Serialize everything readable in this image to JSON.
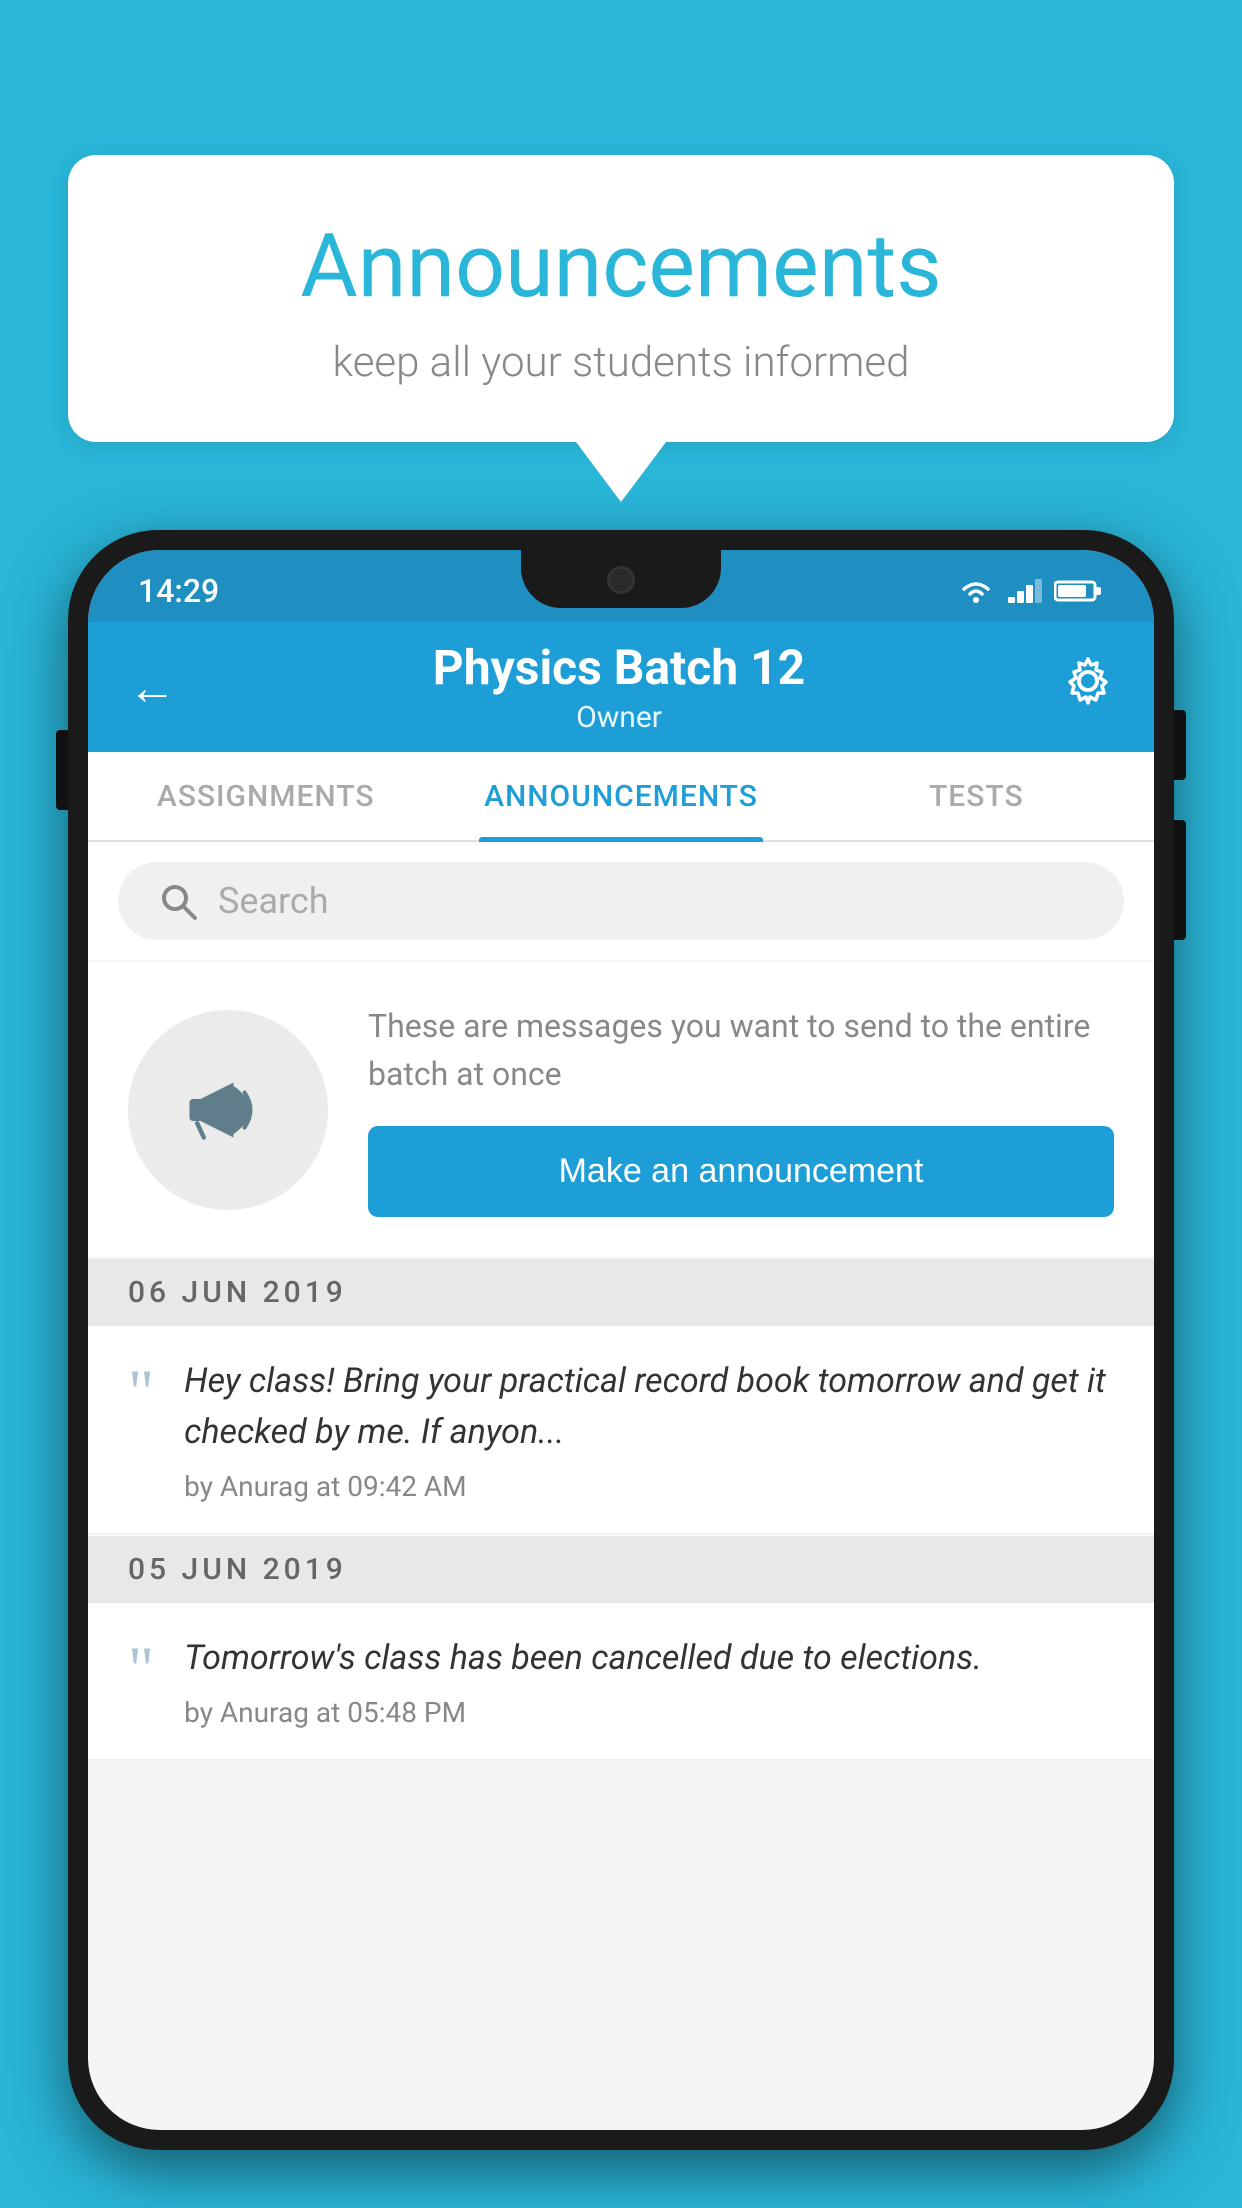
{
  "background_color": "#29b6d8",
  "speech_bubble": {
    "title": "Announcements",
    "subtitle": "keep all your students informed"
  },
  "status_bar": {
    "time": "14:29"
  },
  "app_header": {
    "title": "Physics Batch 12",
    "subtitle": "Owner",
    "back_label": "←"
  },
  "tabs": [
    {
      "label": "ASSIGNMENTS",
      "active": false
    },
    {
      "label": "ANNOUNCEMENTS",
      "active": true
    },
    {
      "label": "TESTS",
      "active": false
    }
  ],
  "search": {
    "placeholder": "Search"
  },
  "announcement_prompt": {
    "description": "These are messages you want to send to the entire batch at once",
    "button_label": "Make an announcement"
  },
  "announcements": [
    {
      "date": "06  JUN  2019",
      "text": "Hey class! Bring your practical record book tomorrow and get it checked by me. If anyon...",
      "meta": "by Anurag at 09:42 AM"
    },
    {
      "date": "05  JUN  2019",
      "text": "Tomorrow's class has been cancelled due to elections.",
      "meta": "by Anurag at 05:48 PM"
    }
  ]
}
